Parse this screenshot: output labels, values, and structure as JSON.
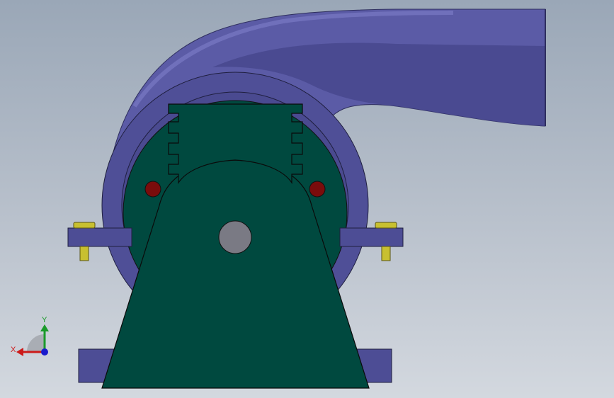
{
  "viewport": {
    "background_top": "#9aa7b7",
    "background_bottom": "#d3d8df"
  },
  "model": {
    "volute_color": "#5b5ba6",
    "volute_dark": "#3e3e82",
    "frame_color": "#4a4a90",
    "pedestal_color": "#004940",
    "shaft_color": "#7a7a84",
    "pin_color": "#7a0c0c",
    "bolt_color": "#c8c030"
  },
  "triad": {
    "x_label": "X",
    "y_label": "Y",
    "x_color": "#cc1a1a",
    "y_color": "#1a9a2a",
    "z_color": "#1a1acc"
  }
}
